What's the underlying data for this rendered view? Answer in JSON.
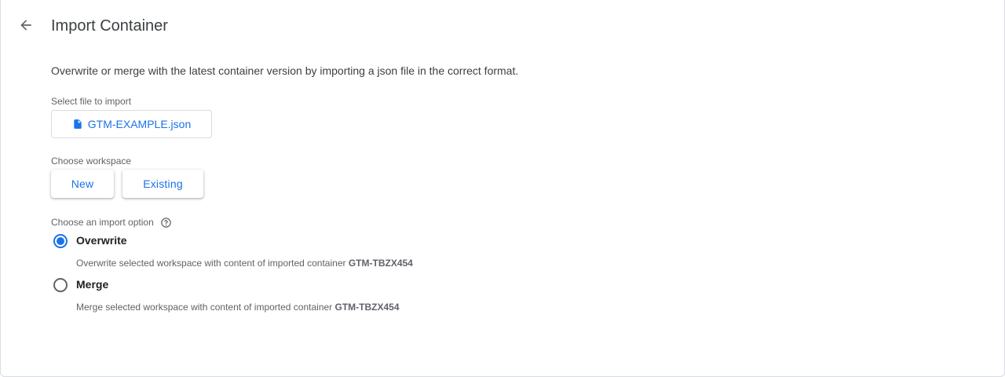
{
  "header": {
    "title": "Import Container",
    "back_icon": "arrow-back-icon"
  },
  "description": "Overwrite or merge with the latest container version by importing a json file in the correct format.",
  "file": {
    "label": "Select file to import",
    "filename": "GTM-EXAMPLE.json",
    "icon": "file-icon"
  },
  "workspace": {
    "label": "Choose workspace",
    "new_label": "New",
    "existing_label": "Existing"
  },
  "import_option": {
    "label": "Choose an import option",
    "help_icon": "help-icon",
    "selected": "Overwrite",
    "options": [
      {
        "label": "Overwrite",
        "description": "Overwrite selected workspace with content of imported container",
        "container_id": "GTM-TBZX454"
      },
      {
        "label": "Merge",
        "description": "Merge selected workspace with content of imported container",
        "container_id": "GTM-TBZX454"
      }
    ]
  },
  "colors": {
    "accent": "#1a73e8",
    "text_primary": "#202124",
    "text_secondary": "#5f6368",
    "border": "#dadce0"
  }
}
